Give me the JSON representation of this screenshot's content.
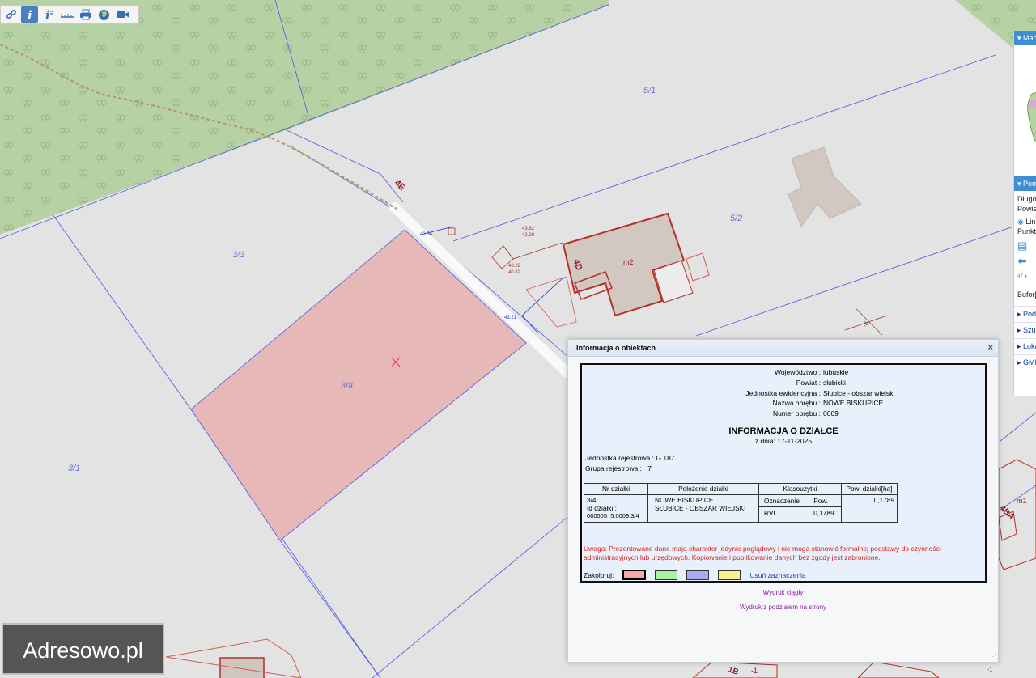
{
  "toolbar": {
    "tools": [
      "link-icon",
      "info-icon",
      "info-italic-icon",
      "measure-icon",
      "print-icon",
      "globe-icon",
      "camera-icon"
    ],
    "active_tool": "info-icon"
  },
  "map": {
    "parcel_labels": [
      "5/1",
      "5/2",
      "3/3",
      "3/4",
      "3/1",
      "4E",
      "4D",
      "m2",
      "4BA",
      "m1",
      "1B",
      "-1"
    ],
    "survey_labels": [
      "43.54",
      "43.62",
      "42.29",
      "43.22",
      "40.82",
      "43.21",
      "-3",
      "-1"
    ],
    "colors": {
      "forest": "#b6d1a3",
      "selected_parcel": "#e6b8b8",
      "parcel_boundary": "#4c57e6",
      "building": "#c0392b"
    }
  },
  "side_panel": {
    "header1": "Mapa",
    "header2": "Pomiar",
    "rows": [
      "Długość",
      "Powierzchnia",
      "Linia",
      "Punkt",
      "Bufor[m]"
    ],
    "links": [
      "Podział",
      "Szukaj",
      "Lokalizacja",
      "GMINA Pilzno"
    ]
  },
  "popup": {
    "title": "Informacja o obiektach",
    "close": "×",
    "header_fields": [
      {
        "k": "Województwo :",
        "v": "lubuskie"
      },
      {
        "k": "Powiat :",
        "v": "słubicki"
      },
      {
        "k": "Jednostka ewidencyjna :",
        "v": "Słubice - obszar wiejski"
      },
      {
        "k": "Nazwa obrębu :",
        "v": "NOWE BISKUPICE"
      },
      {
        "k": "Numer obrębu :",
        "v": "0009"
      }
    ],
    "info_title": "INFORMACJA O DZIAŁCE",
    "date": "z dnia: 17-11-2025",
    "unit_label": "Jednostka rejestrowa :",
    "unit_value": "G.187",
    "group_label": "Grupa rejestrowa :",
    "group_value": "7",
    "table": {
      "headers": [
        "Nr działki",
        "Położenie działki",
        "Klasoużytki",
        "Pow. działki[ha]"
      ],
      "nr": "3/4",
      "id_label": "Id działki :",
      "id_value": "080505_5.0009.3/4",
      "location_line1": "NOWE BISKUPICE",
      "location_line2": "SŁUBICE - OBSZAR WIEJSKI",
      "class_headers": [
        "Oznaczenie",
        "Pow."
      ],
      "class_code": "RVI",
      "class_area": "0,1789",
      "area": "0,1789"
    },
    "warning": "Uwaga: Prezentowane dane mają charakter jedynie poglądowy i nie mogą stanowić formalnej podstawy do czynności administracyjnych lub urzędowych. Kopiowanie i publikowanie danych bez zgody jest zabronione.",
    "colorize_label": "Zakoloruj:",
    "swatch_colors": [
      "#f4aaaa",
      "#a9f3a3",
      "#a8abf0",
      "#f6f28f"
    ],
    "clear_selection": "Usuń zaznaczenia",
    "print_continuous": "Wydruk ciągły",
    "print_pages": "Wydruk z podziałem na strony"
  },
  "watermark": "Adresowo.pl"
}
